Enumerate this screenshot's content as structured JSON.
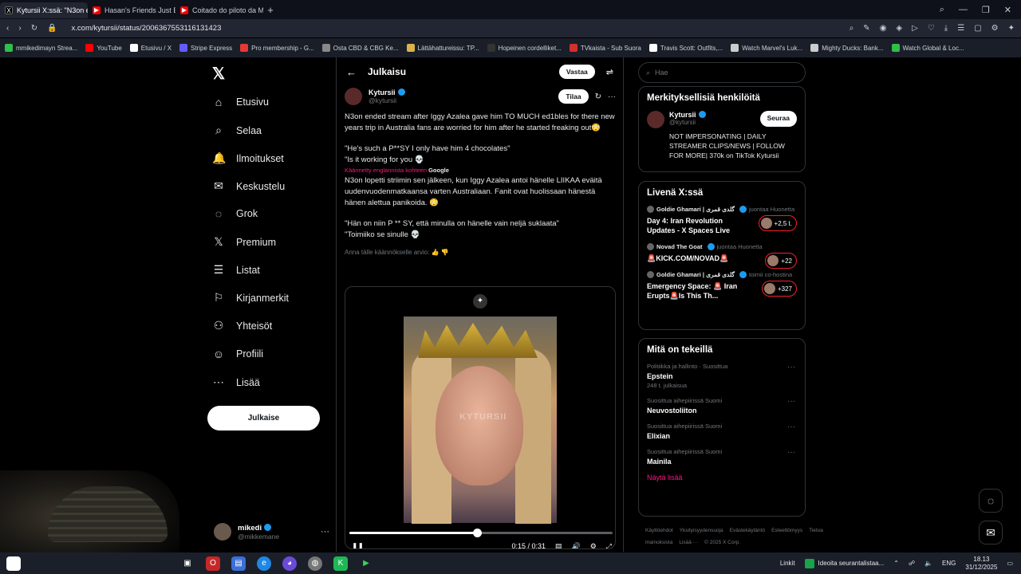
{
  "browser": {
    "tabs": [
      {
        "label": "Kytursii X:ssä: \"N3on e",
        "active": true,
        "color": "#ffffff"
      },
      {
        "label": "Hasan's Friends Just Expo",
        "active": false,
        "color": "#ff0000"
      },
      {
        "label": "Coitado do piloto da Mot",
        "active": false,
        "color": "#ff0000"
      }
    ],
    "url": "x.com/kytursii/status/2006367553116131423",
    "bookmarks": [
      {
        "label": "mmikedimayn Strea...",
        "color": "#2fbf4a"
      },
      {
        "label": "YouTube",
        "color": "#ff0000"
      },
      {
        "label": "Etusivu / X",
        "color": "#ffffff"
      },
      {
        "label": "Stripe Express",
        "color": "#635bff"
      },
      {
        "label": "Pro membership - G...",
        "color": "#e53935"
      },
      {
        "label": "Osta CBD & CBG Ke...",
        "color": "#888888"
      },
      {
        "label": "Lättähattureissu: TP...",
        "color": "#d9b34a"
      },
      {
        "label": "Hopeinen cordelliket...",
        "color": "#333333"
      },
      {
        "label": "TVkaista - Sub Suora",
        "color": "#d32f2f"
      },
      {
        "label": "Travis Scott: Outfits,...",
        "color": "#ffffff"
      },
      {
        "label": "Watch Marvel's Luk...",
        "color": "#cccccc"
      },
      {
        "label": "Mighty Ducks: Bank...",
        "color": "#cccccc"
      },
      {
        "label": "Watch Global & Loc...",
        "color": "#2fbf4a"
      }
    ]
  },
  "nav": {
    "items": [
      {
        "label": "Etusivu",
        "icon": "home-icon",
        "glyph": "⌂"
      },
      {
        "label": "Selaa",
        "icon": "search-icon",
        "glyph": "⌕"
      },
      {
        "label": "Ilmoitukset",
        "icon": "bell-icon",
        "glyph": "🔔"
      },
      {
        "label": "Keskustelu",
        "icon": "envelope-icon",
        "glyph": "✉"
      },
      {
        "label": "Grok",
        "icon": "grok-icon",
        "glyph": "◌"
      },
      {
        "label": "Premium",
        "icon": "x-premium-icon",
        "glyph": "𝕏"
      },
      {
        "label": "Listat",
        "icon": "list-icon",
        "glyph": "☰"
      },
      {
        "label": "Kirjanmerkit",
        "icon": "bookmark-icon",
        "glyph": "⚐"
      },
      {
        "label": "Yhteisöt",
        "icon": "communities-icon",
        "glyph": "⚇"
      },
      {
        "label": "Profiili",
        "icon": "profile-icon",
        "glyph": "☺"
      },
      {
        "label": "Lisää",
        "icon": "more-circle-icon",
        "glyph": "⋯"
      }
    ],
    "post_button": "Julkaise",
    "account": {
      "name": "mikedi",
      "handle": "@mikkemane"
    }
  },
  "main": {
    "header_title": "Julkaisu",
    "reply_button": "Vastaa",
    "author": {
      "name": "Kytursii",
      "handle": "@kytursii",
      "subscribe": "Tilaa"
    },
    "tweet": {
      "line1": "N3on ended stream after Iggy Azalea gave him TO MUCH ed1bles for there new years trip in Australia fans are worried for him after he started freaking out😳",
      "line2": "\"He's such a P**SY I only have him 4 chocolates\"",
      "line3": "\"Is it working for you 💀",
      "translated_label": "Käännetty englannista kohteen",
      "translated_by": "Google",
      "fi1": "N3on lopetti striimin sen jälkeen, kun Iggy Azalea antoi hänelle LIIKAA eväitä uudenvuodenmatkaansa varten Australiaan. Fanit ovat huolissaan hänestä hänen alettua panikoida. 😳",
      "fi2": "\"Hän on niin P ** SY, että minulla on hänelle vain neljä suklaata\"",
      "fi3": "\"Toimiiko se sinulle 💀",
      "rate": "Anna tälle käännökselle arvio:"
    },
    "video": {
      "watermark": "KYTURSII",
      "time": "0:15 / 0:31",
      "progress": 0.485
    }
  },
  "right": {
    "search_placeholder": "Hae",
    "relevant_title": "Merkityksellisiä henkilöitä",
    "relevant": {
      "name": "Kytursii",
      "handle": "@kytursii",
      "follow": "Seuraa",
      "bio": "NOT IMPERSONATING | DAILY STREAMER CLIPS/NEWS | FOLLOW FOR MORE| 370k on TikTok Kytursii"
    },
    "live_title": "Livenä X:ssä",
    "live": [
      {
        "host": "Goldie Ghamari | گلدی قمری",
        "role": "juontaa Huonetta",
        "title": "Day 4: Iran Revolution Updates - X Spaces Live",
        "count": "+2,5 t."
      },
      {
        "host": "Novad The Goat",
        "role": "juontaa Huonetta",
        "title": "🚨KICK.COM/NOVAD🚨",
        "count": "+22"
      },
      {
        "host": "Goldie Ghamari | گلدی قمری",
        "role": "toimii co-hostina",
        "title": "Emergency Space: 🚨 Iran Erupts🚨Is This Th...",
        "count": "+327"
      }
    ],
    "trends_title": "Mitä on tekeillä",
    "trends": [
      {
        "ctx": "Politiikka ja hallinto · Suosittua",
        "name": "Epstein",
        "count": "248 t. julkaisua"
      },
      {
        "ctx": "Suosittua aihepiirissä Suomi",
        "name": "Neuvostoliiton",
        "count": ""
      },
      {
        "ctx": "Suosittua aihepiirissä Suomi",
        "name": "Elixian",
        "count": ""
      },
      {
        "ctx": "Suosittua aihepiirissä Suomi",
        "name": "Mainila",
        "count": ""
      }
    ],
    "show_more": "Näytä lisää",
    "footer": [
      "Käyttöehdot",
      "Yksityisyydensuoja",
      "Evästekäytäntö",
      "Esteettömyys",
      "Tietoa mainoksista",
      "Lisää ···",
      "© 2025 X Corp."
    ]
  },
  "taskbar": {
    "links": "Linkit",
    "news": "Ideoita seurantalistaa...",
    "lang": "ENG",
    "time": "18.13",
    "date": "31/12/2025"
  }
}
